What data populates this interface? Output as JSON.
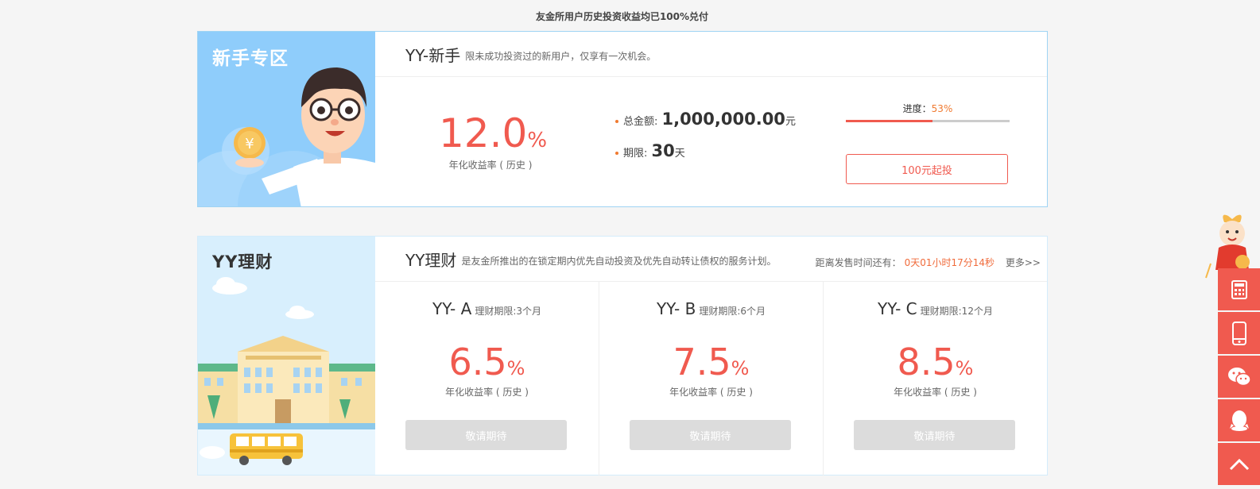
{
  "notice": "友金所用户历史投资收益均已100%兑付",
  "newbie": {
    "side_title": "新手专区",
    "name": "YY-新手",
    "desc": "限未成功投资过的新用户，仅享有一次机会。",
    "rate": "12.0",
    "pct": "%",
    "rate_label": "年化收益率 ( 历史 )",
    "total_label": "总金额:",
    "total_value": "1,000,000.00",
    "total_unit": "元",
    "term_label": "期限:",
    "term_value": "30",
    "term_unit": "天",
    "progress_label": "进度：",
    "progress_value": "53%",
    "progress_fraction": 0.53,
    "button": "100元起投"
  },
  "yy": {
    "side_title": "YY理财",
    "name": "YY理财",
    "desc": "是友金所推出的在锁定期内优先自动投资及优先自动转让债权的服务计划。",
    "countdown_label": "距离发售时间还有：",
    "countdown_value": "0天01小时17分14秒",
    "more": "更多>>",
    "products": [
      {
        "name": "YY- A",
        "term": "理财期限:3个月",
        "rate": "6.5",
        "pct": "%",
        "label": "年化收益率 ( 历史 )",
        "button": "敬请期待"
      },
      {
        "name": "YY- B",
        "term": "理财期限:6个月",
        "rate": "7.5",
        "pct": "%",
        "label": "年化收益率 ( 历史 )",
        "button": "敬请期待"
      },
      {
        "name": "YY- C",
        "term": "理财期限:12个月",
        "rate": "8.5",
        "pct": "%",
        "label": "年化收益率 ( 历史 )",
        "button": "敬请期待"
      }
    ]
  },
  "colors": {
    "accent": "#f05a4f",
    "orange": "#f07a30",
    "newbie_bg": "#8fcdfb",
    "yy_bg": "#d8effd"
  },
  "fixbar": [
    "calculator-icon",
    "mobile-phone-icon",
    "wechat-icon",
    "qq-icon",
    "back-to-top-icon"
  ]
}
